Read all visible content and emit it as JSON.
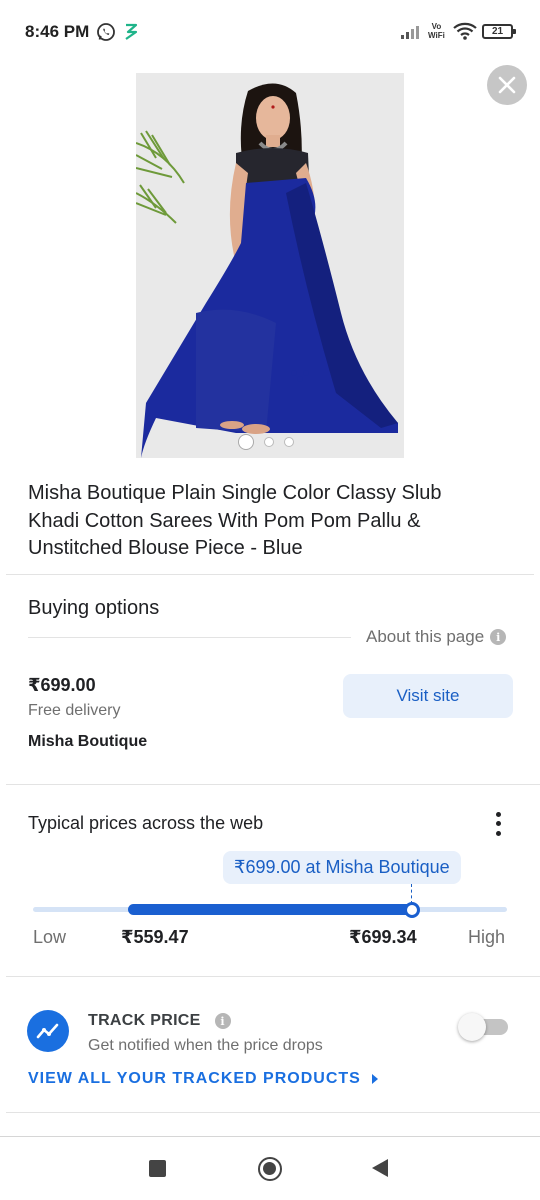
{
  "status_bar": {
    "time": "8:46 PM",
    "icons": [
      "whatsapp-icon",
      "z-notification-icon",
      "signal-icon",
      "vowifi-icon",
      "wifi-icon",
      "battery-icon"
    ],
    "vowifi_top": "Vo",
    "vowifi_bottom": "WiFi",
    "battery": "21"
  },
  "product": {
    "image_alt": "Woman wearing blue khadi cotton saree",
    "image_count": 3,
    "active_image": 1,
    "title": "Misha Boutique Plain Single Color Classy Slub Khadi Cotton Sarees With Pom Pom Pallu & Unstitched Blouse Piece - Blue"
  },
  "buying_options": {
    "heading": "Buying options",
    "about_link": "About this page",
    "offer": {
      "price": "₹699.00",
      "delivery": "Free delivery",
      "seller": "Misha Boutique",
      "button_label": "Visit site"
    }
  },
  "typical_prices": {
    "heading": "Typical prices across the web",
    "tooltip": "₹699.00 at Misha Boutique",
    "low_label": "Low",
    "low_value": "₹559.47",
    "high_value": "₹699.34",
    "high_label": "High"
  },
  "track_price": {
    "title": "TRACK PRICE",
    "subtitle": "Get notified when the price drops",
    "toggle_on": false,
    "view_all": "VIEW ALL YOUR TRACKED PRODUCTS"
  },
  "colors": {
    "accent": "#1a5fd0",
    "link": "#1a6fe0",
    "button_bg": "#e8f0fb",
    "saree_blue": "#1b2a9e"
  }
}
